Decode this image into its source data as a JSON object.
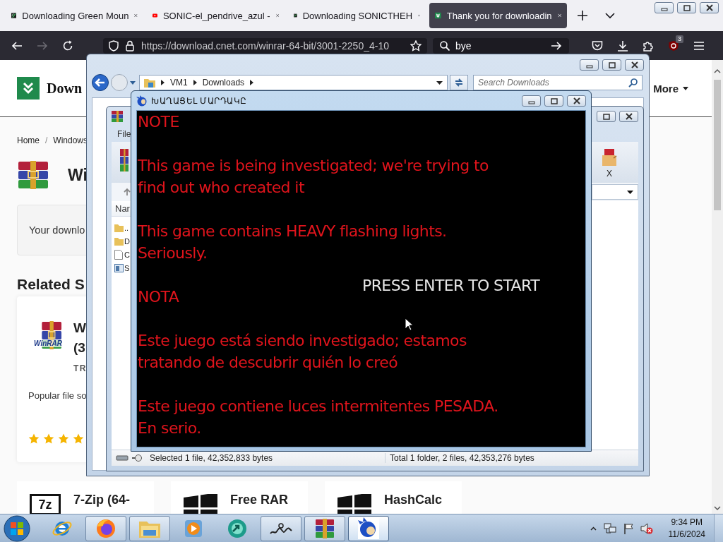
{
  "browser": {
    "tabs": [
      {
        "title": "Downloading Green Moun",
        "kind": "stripes",
        "selected": false
      },
      {
        "title": "SONIC-el_pendrive_azul -",
        "kind": "play",
        "selected": false
      },
      {
        "title": "Downloading SONICTHEH",
        "kind": "stripes",
        "selected": false
      },
      {
        "title": "Thank you for downloadin",
        "kind": "chevrons",
        "selected": true
      }
    ],
    "forward_disabled": true,
    "url": "https://download.cnet.com/winrar-64-bit/3001-2250_4-10",
    "search_value": "bye",
    "extension_badge": "3"
  },
  "page": {
    "logo_text": "Down",
    "menu_more": "More",
    "breadcrumb": [
      "Home",
      "/",
      "Windows"
    ],
    "title": "Wi",
    "notice": "Your downlo",
    "related_heading": "Related S",
    "featured": {
      "logo_text": "WinRAR",
      "title_lines": [
        "W",
        "(3"
      ],
      "label": "TR",
      "description": "Popular file so",
      "stars": 4
    },
    "more_cards": [
      {
        "kind": "sevenzip",
        "logo_text": "7z",
        "title": "7-Zip (64-"
      },
      {
        "kind": "windows",
        "title": "Free RAR"
      },
      {
        "kind": "windows",
        "title": "HashCalc"
      }
    ]
  },
  "explorer": {
    "path": [
      "VM1",
      "Downloads"
    ],
    "search_placeholder": "Search Downloads"
  },
  "winrar": {
    "menu": [
      "File"
    ],
    "toolbar_label": "X",
    "column": "Nar",
    "rows": [
      {
        "kind": "folder",
        "name": ".."
      },
      {
        "kind": "folder",
        "name": "D"
      },
      {
        "kind": "file",
        "name": "C"
      },
      {
        "kind": "app",
        "name": "S"
      }
    ],
    "status_left": "Selected 1 file, 42,352,833 bytes",
    "status_right": "Total 1 folder, 2 files, 42,353,276 bytes"
  },
  "game": {
    "title": "ԽԱՂԱՑԵԼ ՄԱՐԴԱԿԸ",
    "paragraphs": [
      [
        "NOTE"
      ],
      [
        "This game is being investigated; we're trying to",
        "find out who created it"
      ],
      [
        "This game contains HEAVY flashing lights.",
        "Seriously."
      ],
      [
        "NOTA"
      ],
      [
        "Este juego está siendo investigado; estamos",
        "tratando de descubrir quién lo creó"
      ],
      [
        "Este juego contiene luces intermitentes PESADA.",
        "En serio."
      ]
    ],
    "prompt": "PRESS ENTER TO START"
  },
  "taskbar": {
    "buttons": [
      {
        "kind": "ie",
        "running": false,
        "selected": false
      },
      {
        "kind": "firefox",
        "running": true,
        "selected": false
      },
      {
        "kind": "folder",
        "running": true,
        "selected": false
      },
      {
        "kind": "media",
        "running": false,
        "selected": false
      },
      {
        "kind": "app",
        "running": false,
        "selected": false
      },
      {
        "kind": "squiggle",
        "running": true,
        "selected": false
      },
      {
        "kind": "archive",
        "running": true,
        "selected": false
      },
      {
        "kind": "game",
        "running": true,
        "selected": true
      }
    ],
    "time": "9:34 PM",
    "date": "11/6/2024"
  }
}
